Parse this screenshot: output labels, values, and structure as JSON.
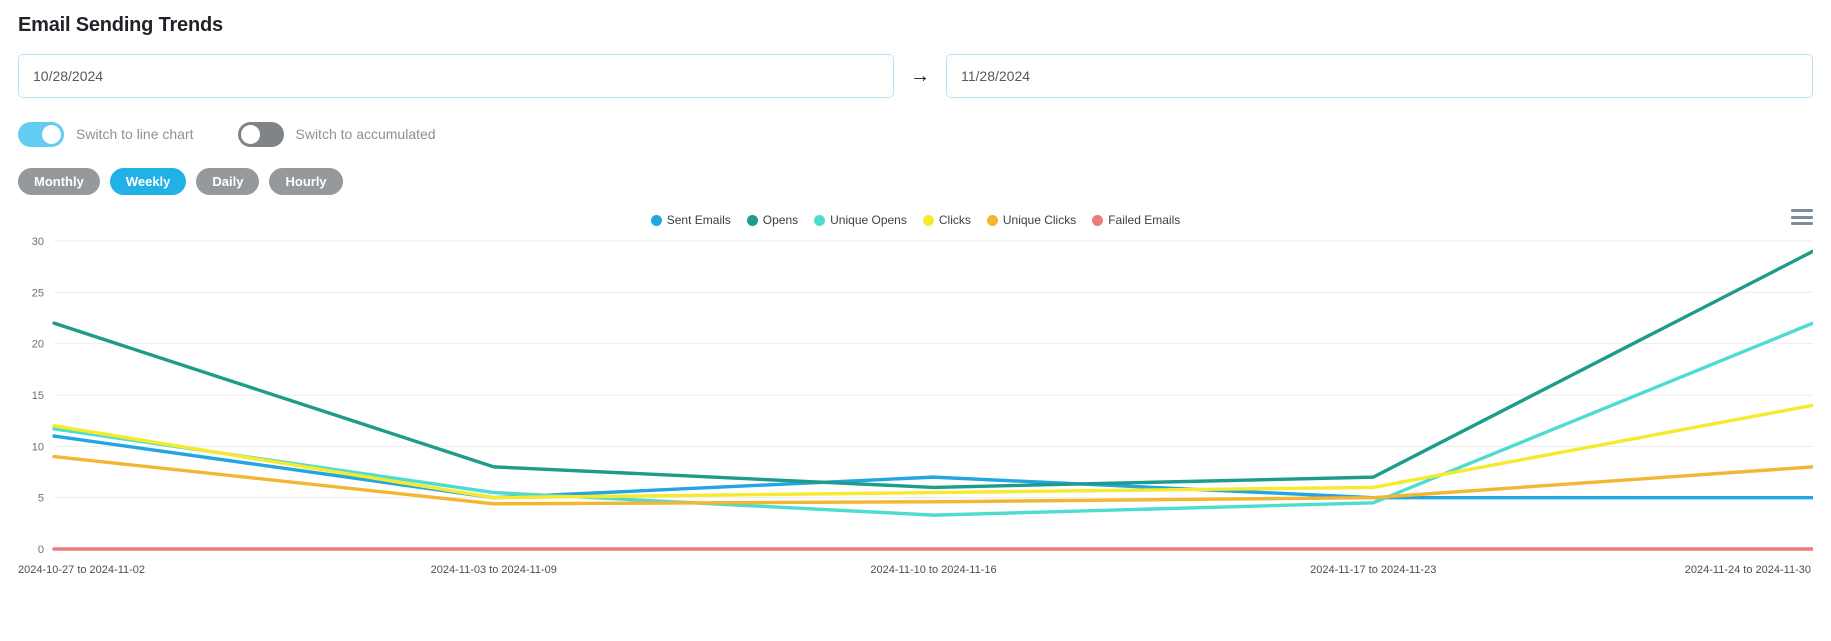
{
  "page_title": "Email Sending Trends",
  "date_range": {
    "from_value": "10/28/2024",
    "to_value": "11/28/2024",
    "from_placeholder": "mm/dd/yyyy",
    "to_placeholder": "mm/dd/yyyy",
    "separator": "→"
  },
  "toggles": [
    {
      "label": "Switch to line chart",
      "state": "on"
    },
    {
      "label": "Switch to accumulated",
      "state": "off"
    }
  ],
  "period_buttons": [
    {
      "label": "Monthly",
      "active": false
    },
    {
      "label": "Weekly",
      "active": true
    },
    {
      "label": "Daily",
      "active": false
    },
    {
      "label": "Hourly",
      "active": false
    }
  ],
  "menu_icon": "hamburger-menu-icon",
  "colors": {
    "accent_blue": "#22b1e6",
    "toggle_on": "#62cdf3",
    "toggle_off": "#808487",
    "pill_inactive": "#95999c",
    "input_border": "#b9e3f4"
  },
  "chart_data": {
    "type": "line",
    "title": "",
    "xlabel": "",
    "ylabel": "",
    "ylim": [
      0,
      30
    ],
    "yticks": [
      0,
      5,
      10,
      15,
      20,
      25,
      30
    ],
    "grid": true,
    "legend_position": "top-center",
    "categories": [
      "2024-10-27 to 2024-11-02",
      "2024-11-03 to 2024-11-09",
      "2024-11-10 to 2024-11-16",
      "2024-11-17 to 2024-11-23",
      "2024-11-24 to 2024-11-30"
    ],
    "series": [
      {
        "name": "Sent Emails",
        "color": "#22a5e0",
        "values": [
          11,
          5,
          7,
          5,
          5
        ]
      },
      {
        "name": "Opens",
        "color": "#1d9c8c",
        "values": [
          22,
          8,
          6,
          7,
          29
        ]
      },
      {
        "name": "Unique Opens",
        "color": "#4ddcd0",
        "values": [
          11.7,
          5.5,
          3.3,
          4.5,
          22
        ]
      },
      {
        "name": "Clicks",
        "color": "#f7e92e",
        "values": [
          12,
          5,
          5.5,
          6,
          14
        ]
      },
      {
        "name": "Unique Clicks",
        "color": "#f2b632",
        "values": [
          9,
          4.4,
          4.6,
          5,
          8
        ]
      },
      {
        "name": "Failed Emails",
        "color": "#ea7c7c",
        "values": [
          0,
          0,
          0,
          0,
          0
        ]
      }
    ]
  }
}
